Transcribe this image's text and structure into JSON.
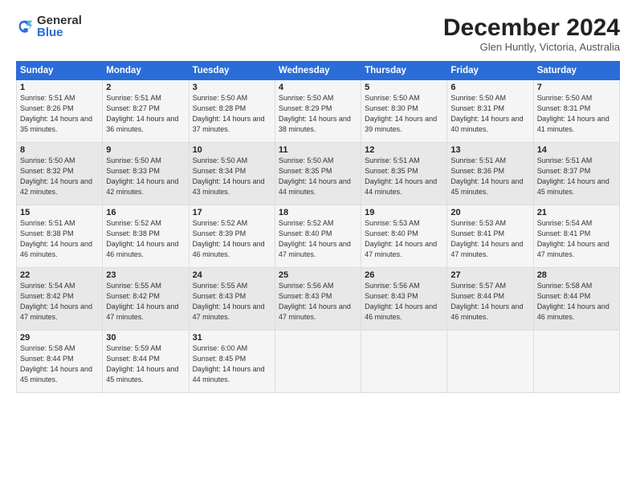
{
  "logo": {
    "general": "General",
    "blue": "Blue"
  },
  "title": "December 2024",
  "location": "Glen Huntly, Victoria, Australia",
  "days_header": [
    "Sunday",
    "Monday",
    "Tuesday",
    "Wednesday",
    "Thursday",
    "Friday",
    "Saturday"
  ],
  "weeks": [
    [
      {
        "day": "1",
        "sunrise": "Sunrise: 5:51 AM",
        "sunset": "Sunset: 8:26 PM",
        "daylight": "Daylight: 14 hours and 35 minutes."
      },
      {
        "day": "2",
        "sunrise": "Sunrise: 5:51 AM",
        "sunset": "Sunset: 8:27 PM",
        "daylight": "Daylight: 14 hours and 36 minutes."
      },
      {
        "day": "3",
        "sunrise": "Sunrise: 5:50 AM",
        "sunset": "Sunset: 8:28 PM",
        "daylight": "Daylight: 14 hours and 37 minutes."
      },
      {
        "day": "4",
        "sunrise": "Sunrise: 5:50 AM",
        "sunset": "Sunset: 8:29 PM",
        "daylight": "Daylight: 14 hours and 38 minutes."
      },
      {
        "day": "5",
        "sunrise": "Sunrise: 5:50 AM",
        "sunset": "Sunset: 8:30 PM",
        "daylight": "Daylight: 14 hours and 39 minutes."
      },
      {
        "day": "6",
        "sunrise": "Sunrise: 5:50 AM",
        "sunset": "Sunset: 8:31 PM",
        "daylight": "Daylight: 14 hours and 40 minutes."
      },
      {
        "day": "7",
        "sunrise": "Sunrise: 5:50 AM",
        "sunset": "Sunset: 8:31 PM",
        "daylight": "Daylight: 14 hours and 41 minutes."
      }
    ],
    [
      {
        "day": "8",
        "sunrise": "Sunrise: 5:50 AM",
        "sunset": "Sunset: 8:32 PM",
        "daylight": "Daylight: 14 hours and 42 minutes."
      },
      {
        "day": "9",
        "sunrise": "Sunrise: 5:50 AM",
        "sunset": "Sunset: 8:33 PM",
        "daylight": "Daylight: 14 hours and 42 minutes."
      },
      {
        "day": "10",
        "sunrise": "Sunrise: 5:50 AM",
        "sunset": "Sunset: 8:34 PM",
        "daylight": "Daylight: 14 hours and 43 minutes."
      },
      {
        "day": "11",
        "sunrise": "Sunrise: 5:50 AM",
        "sunset": "Sunset: 8:35 PM",
        "daylight": "Daylight: 14 hours and 44 minutes."
      },
      {
        "day": "12",
        "sunrise": "Sunrise: 5:51 AM",
        "sunset": "Sunset: 8:35 PM",
        "daylight": "Daylight: 14 hours and 44 minutes."
      },
      {
        "day": "13",
        "sunrise": "Sunrise: 5:51 AM",
        "sunset": "Sunset: 8:36 PM",
        "daylight": "Daylight: 14 hours and 45 minutes."
      },
      {
        "day": "14",
        "sunrise": "Sunrise: 5:51 AM",
        "sunset": "Sunset: 8:37 PM",
        "daylight": "Daylight: 14 hours and 45 minutes."
      }
    ],
    [
      {
        "day": "15",
        "sunrise": "Sunrise: 5:51 AM",
        "sunset": "Sunset: 8:38 PM",
        "daylight": "Daylight: 14 hours and 46 minutes."
      },
      {
        "day": "16",
        "sunrise": "Sunrise: 5:52 AM",
        "sunset": "Sunset: 8:38 PM",
        "daylight": "Daylight: 14 hours and 46 minutes."
      },
      {
        "day": "17",
        "sunrise": "Sunrise: 5:52 AM",
        "sunset": "Sunset: 8:39 PM",
        "daylight": "Daylight: 14 hours and 46 minutes."
      },
      {
        "day": "18",
        "sunrise": "Sunrise: 5:52 AM",
        "sunset": "Sunset: 8:40 PM",
        "daylight": "Daylight: 14 hours and 47 minutes."
      },
      {
        "day": "19",
        "sunrise": "Sunrise: 5:53 AM",
        "sunset": "Sunset: 8:40 PM",
        "daylight": "Daylight: 14 hours and 47 minutes."
      },
      {
        "day": "20",
        "sunrise": "Sunrise: 5:53 AM",
        "sunset": "Sunset: 8:41 PM",
        "daylight": "Daylight: 14 hours and 47 minutes."
      },
      {
        "day": "21",
        "sunrise": "Sunrise: 5:54 AM",
        "sunset": "Sunset: 8:41 PM",
        "daylight": "Daylight: 14 hours and 47 minutes."
      }
    ],
    [
      {
        "day": "22",
        "sunrise": "Sunrise: 5:54 AM",
        "sunset": "Sunset: 8:42 PM",
        "daylight": "Daylight: 14 hours and 47 minutes."
      },
      {
        "day": "23",
        "sunrise": "Sunrise: 5:55 AM",
        "sunset": "Sunset: 8:42 PM",
        "daylight": "Daylight: 14 hours and 47 minutes."
      },
      {
        "day": "24",
        "sunrise": "Sunrise: 5:55 AM",
        "sunset": "Sunset: 8:43 PM",
        "daylight": "Daylight: 14 hours and 47 minutes."
      },
      {
        "day": "25",
        "sunrise": "Sunrise: 5:56 AM",
        "sunset": "Sunset: 8:43 PM",
        "daylight": "Daylight: 14 hours and 47 minutes."
      },
      {
        "day": "26",
        "sunrise": "Sunrise: 5:56 AM",
        "sunset": "Sunset: 8:43 PM",
        "daylight": "Daylight: 14 hours and 46 minutes."
      },
      {
        "day": "27",
        "sunrise": "Sunrise: 5:57 AM",
        "sunset": "Sunset: 8:44 PM",
        "daylight": "Daylight: 14 hours and 46 minutes."
      },
      {
        "day": "28",
        "sunrise": "Sunrise: 5:58 AM",
        "sunset": "Sunset: 8:44 PM",
        "daylight": "Daylight: 14 hours and 46 minutes."
      }
    ],
    [
      {
        "day": "29",
        "sunrise": "Sunrise: 5:58 AM",
        "sunset": "Sunset: 8:44 PM",
        "daylight": "Daylight: 14 hours and 45 minutes."
      },
      {
        "day": "30",
        "sunrise": "Sunrise: 5:59 AM",
        "sunset": "Sunset: 8:44 PM",
        "daylight": "Daylight: 14 hours and 45 minutes."
      },
      {
        "day": "31",
        "sunrise": "Sunrise: 6:00 AM",
        "sunset": "Sunset: 8:45 PM",
        "daylight": "Daylight: 14 hours and 44 minutes."
      },
      null,
      null,
      null,
      null
    ]
  ]
}
